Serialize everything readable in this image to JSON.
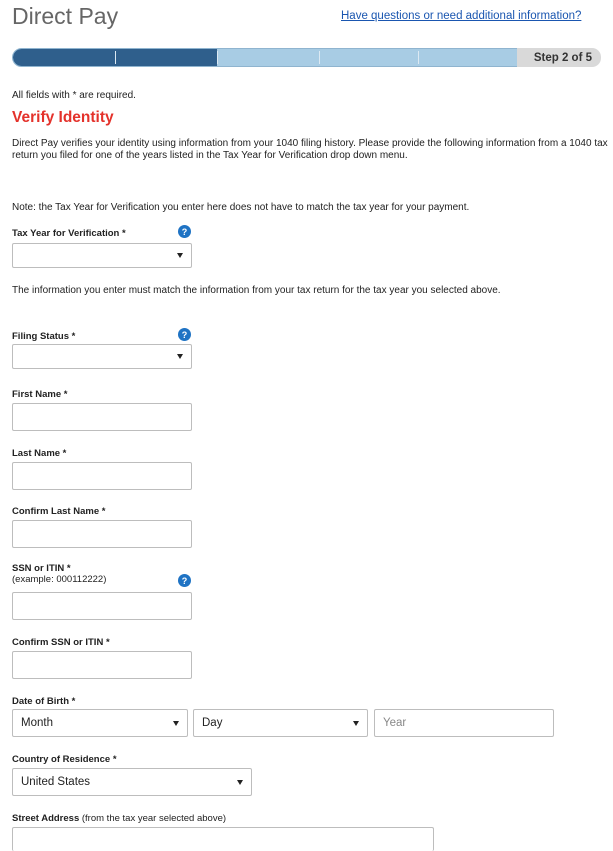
{
  "header": {
    "title": "Direct Pay",
    "help_link": "Have questions or need additional information?"
  },
  "progress": {
    "step_label": "Step 2 of 5",
    "current_step": 2,
    "total_steps": 5,
    "colors": {
      "complete": "#2f5f8c",
      "incomplete": "#a8cce4",
      "step_box": "#d9d9d9"
    }
  },
  "form": {
    "required_note": "All fields with * are required.",
    "section_title": "Verify Identity",
    "intro": "Direct Pay verifies your identity using information from your 1040 filing history. Please provide the following information from a 1040 tax return you filed for one of the years listed in the Tax Year for Verification drop down menu.",
    "note": "Note: the Tax Year for Verification you enter here does not have to match the tax year for your payment.",
    "tax_year": {
      "label": "Tax Year for Verification *",
      "value": ""
    },
    "match_note": "The information you enter must match the information from your tax return for the tax year you selected above.",
    "filing_status": {
      "label": "Filing Status *",
      "value": ""
    },
    "first_name": {
      "label": "First Name *",
      "value": ""
    },
    "last_name": {
      "label": "Last Name *",
      "value": ""
    },
    "confirm_last_name": {
      "label": "Confirm Last Name *",
      "value": ""
    },
    "ssn": {
      "label": "SSN or ITIN *",
      "example": "(example: 000112222)",
      "value": ""
    },
    "confirm_ssn": {
      "label": "Confirm SSN or ITIN *",
      "value": ""
    },
    "dob": {
      "label": "Date of Birth *",
      "month": "Month",
      "day": "Day",
      "year_placeholder": "Year"
    },
    "country": {
      "label": "Country of Residence *",
      "value": "United States"
    },
    "street": {
      "label_bold": "Street Address",
      "label_plain": " (from the tax year selected above)",
      "value": ""
    }
  },
  "icons": {
    "help": "?"
  },
  "accent_colors": {
    "section_title": "#e4322b",
    "link": "#1a56b0",
    "help_icon": "#1f73c4"
  }
}
